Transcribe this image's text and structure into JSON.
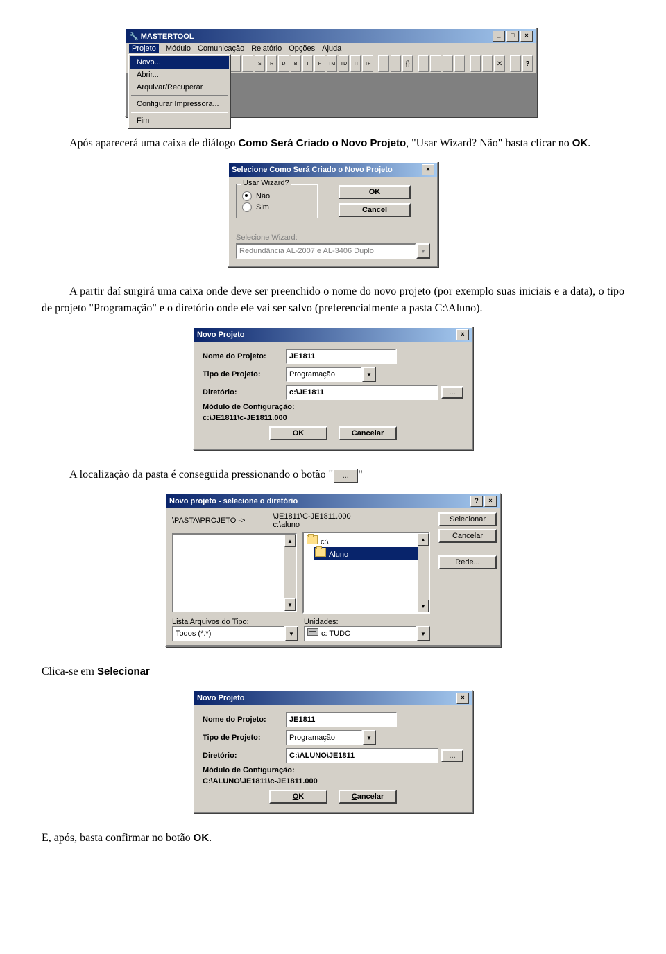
{
  "app_window": {
    "title": "MASTERTOOL",
    "menu": [
      "Projeto",
      "Módulo",
      "Comunicação",
      "Relatório",
      "Opções",
      "Ajuda"
    ],
    "toolbar_icons": [
      "new",
      "open",
      "save",
      "",
      "",
      "S",
      "R",
      "D",
      "B",
      "I",
      "F",
      "TM",
      "TD",
      "TI",
      "TF",
      "",
      "",
      "",
      "[]",
      "",
      "",
      "",
      "",
      "?",
      "",
      "",
      "[?]"
    ],
    "file_menu": [
      "Novo...",
      "Abrir...",
      "Arquivar/Recuperar",
      "Configurar Impressora...",
      "Fim"
    ]
  },
  "para1_pre": "Após aparecerá uma caixa de diálogo ",
  "para1_bold1": "Como Será Criado o Novo Projeto",
  "para1_mid": ", \"Usar Wizard? Não\" basta clicar no ",
  "para1_bold2": "OK",
  "para1_post": ".",
  "wizard_dialog": {
    "title": "Selecione Como Será Criado o Novo Projeto",
    "group": "Usar Wizard?",
    "opt_no": "Não",
    "opt_yes": "Sim",
    "ok": "OK",
    "cancel": "Cancel",
    "sel_label": "Selecione Wizard:",
    "sel_value": "Redundância AL-2007 e AL-3406 Duplo"
  },
  "para2": "A partir daí surgirá uma caixa onde deve ser preenchido o nome do novo projeto (por exemplo suas iniciais e a data), o tipo de projeto \"Programação\" e o diretório onde ele vai ser salvo (preferencialmente a pasta C:\\Aluno).",
  "novo1": {
    "title": "Novo Projeto",
    "lbl_nome": "Nome do Projeto:",
    "nome": "JE1811",
    "lbl_tipo": "Tipo de Projeto:",
    "tipo": "Programação",
    "lbl_dir": "Diretório:",
    "dir": "c:\\JE1811",
    "lbl_mod": "Módulo de Configuração:",
    "mod_path": "c:\\JE1811\\c-JE1811.000",
    "ok": "OK",
    "cancel": "Cancelar",
    "browse": "..."
  },
  "para3_pre": "A localização da pasta é conseguida pressionando o botão \"",
  "para3_btn": "...",
  "para3_post": "\"",
  "dir_dialog": {
    "title": "Novo projeto - selecione o diretório",
    "path_label": "\\PASTA\\PROJETO ->",
    "path_value1": "\\JE1811\\C-JE1811.000",
    "path_value2": "c:\\aluno",
    "lbl_files": "Lista Arquivos do Tipo:",
    "files_value": "Todos (*.*)",
    "lbl_units": "Unidades:",
    "units_value": "c: TUDO",
    "folder_c": "c:\\",
    "folder_aluno": "Aluno",
    "btn_select": "Selecionar",
    "btn_cancel": "Cancelar",
    "btn_net": "Rede..."
  },
  "para4_pre": "Clica-se em ",
  "para4_bold": "Selecionar",
  "novo2": {
    "title": "Novo Projeto",
    "lbl_nome": "Nome do Projeto:",
    "nome": "JE1811",
    "lbl_tipo": "Tipo de Projeto:",
    "tipo": "Programação",
    "lbl_dir": "Diretório:",
    "dir": "C:\\ALUNO\\JE1811",
    "lbl_mod": "Módulo de Configuração:",
    "mod_path": "C:\\ALUNO\\JE1811\\c-JE1811.000",
    "ok": "OK",
    "cancel": "Cancelar",
    "browse": "..."
  },
  "para5_pre": "E, após, basta confirmar no botão ",
  "para5_bold": "OK",
  "para5_post": "."
}
